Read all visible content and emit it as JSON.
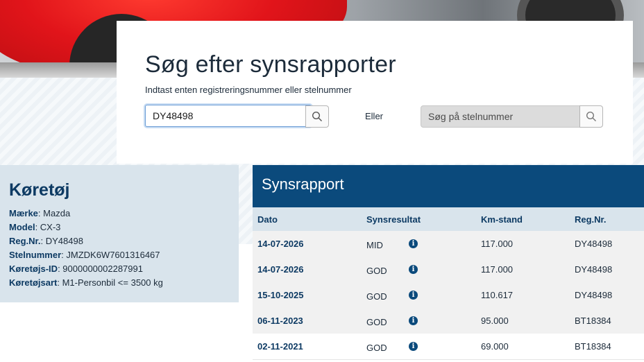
{
  "search": {
    "title": "Søg efter synsrapporter",
    "subtitle": "Indtast enten registreringsnummer eller stelnummer",
    "reg_value": "DY48498",
    "or_label": "Eller",
    "vin_placeholder": "Søg på stelnummer",
    "search_icon": "search-icon"
  },
  "vehicle": {
    "heading": "Køretøj",
    "fields": [
      {
        "label": "Mærke",
        "value": "Mazda"
      },
      {
        "label": "Model",
        "value": "CX-3"
      },
      {
        "label": "Reg.Nr.",
        "value": "DY48498"
      },
      {
        "label": "Stelnummer",
        "value": "JMZDK6W7601316467"
      },
      {
        "label": "Køretøjs-ID",
        "value": "9000000002287991"
      },
      {
        "label": "Køretøjsart",
        "value": "M1-Personbil <= 3500 kg"
      }
    ]
  },
  "report": {
    "title": "Synsrapport",
    "columns": [
      "Dato",
      "Synsresultat",
      "Km-stand",
      "Reg.Nr."
    ],
    "rows": [
      {
        "date": "14-07-2026",
        "result": "MID",
        "km": "117.000",
        "reg": "DY48498"
      },
      {
        "date": "14-07-2026",
        "result": "GOD",
        "km": "117.000",
        "reg": "DY48498"
      },
      {
        "date": "15-10-2025",
        "result": "GOD",
        "km": "110.617",
        "reg": "DY48498"
      },
      {
        "date": "06-11-2023",
        "result": "GOD",
        "km": "95.000",
        "reg": "BT18384"
      },
      {
        "date": "02-11-2021",
        "result": "GOD",
        "km": "69.000",
        "reg": "BT18384"
      }
    ],
    "info_icon": "info-icon",
    "info_glyph": "i"
  },
  "colors": {
    "primary": "#0b4a7c",
    "heading": "#0d3a63",
    "panel": "#d9e4ec",
    "row_alt": "#f1f1f1"
  }
}
